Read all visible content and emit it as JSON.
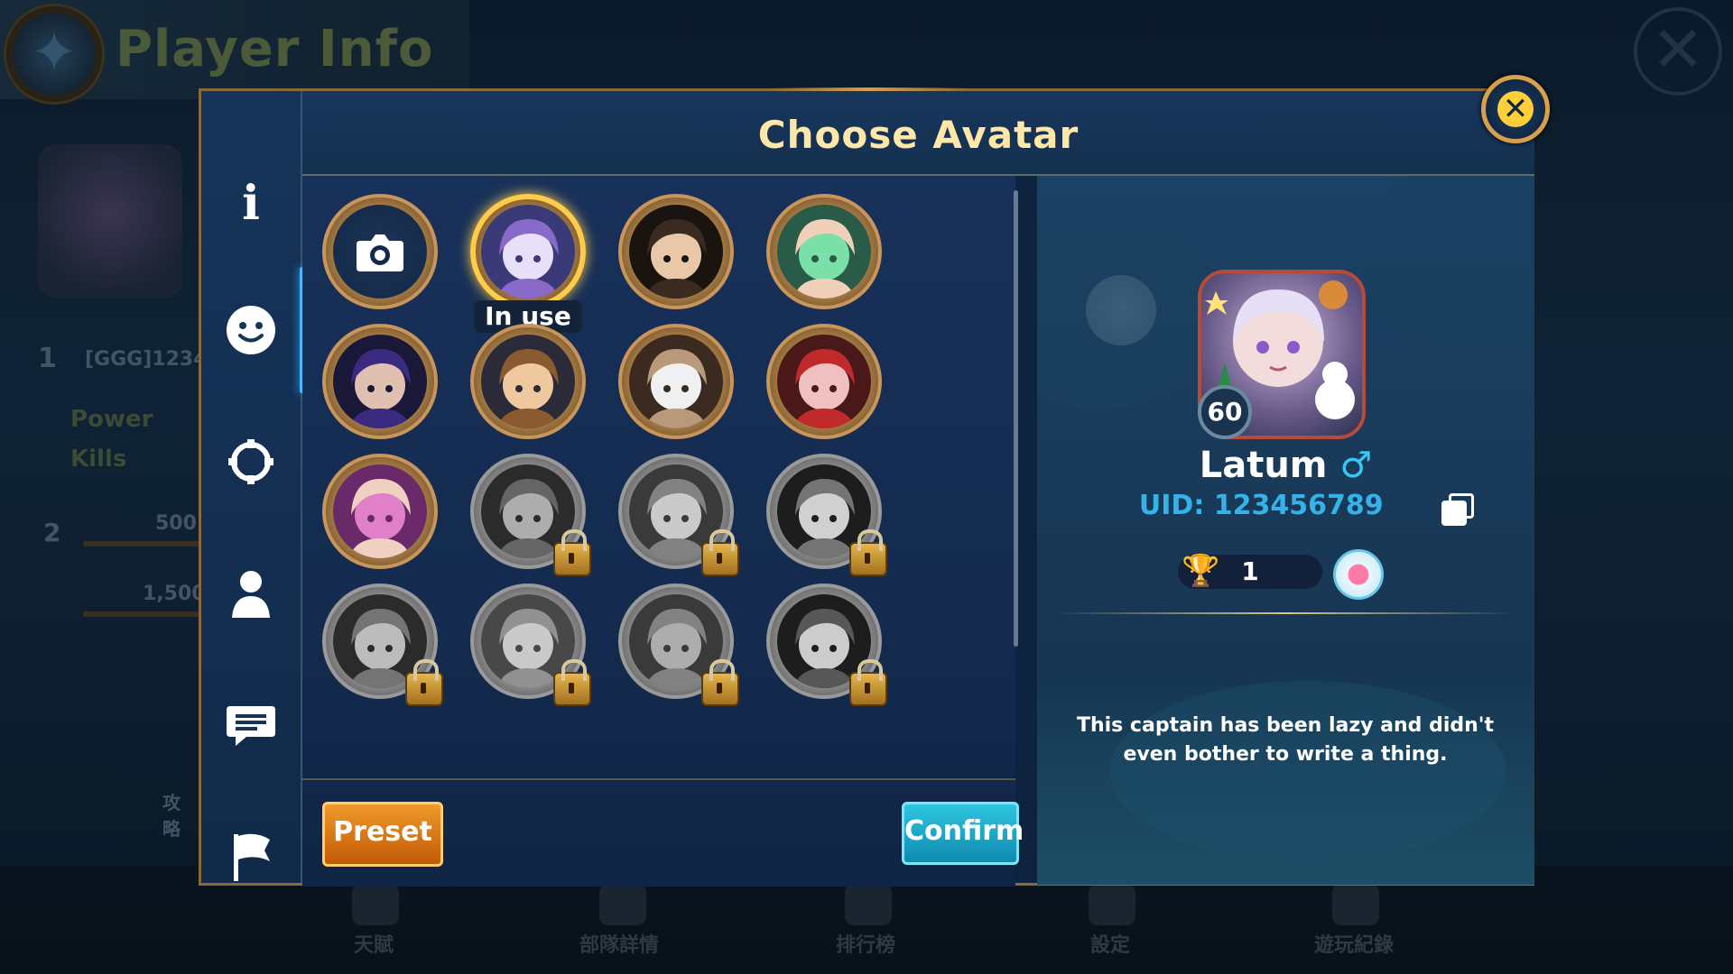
{
  "background": {
    "title": "Player Info",
    "player_tag": "[GGG]1234",
    "stats": [
      {
        "label": "Power"
      },
      {
        "label": "Kills"
      }
    ],
    "level_badge_1": "1",
    "level_badge_2": "2",
    "stat_values": [
      "500",
      "1,500"
    ],
    "side_link": "攻略",
    "bottom_nav": [
      "天賦",
      "部隊詳情",
      "排行榜",
      "設定",
      "遊玩紀錄"
    ]
  },
  "modal": {
    "title": "Choose Avatar",
    "tabs": [
      {
        "icon": "info-icon"
      },
      {
        "icon": "smiley-icon",
        "active": true
      },
      {
        "icon": "settings-ring-icon"
      },
      {
        "icon": "person-icon"
      },
      {
        "icon": "chat-icon"
      },
      {
        "icon": "flag-icon"
      }
    ],
    "avatars": [
      {
        "type": "camera",
        "icon": "camera-icon"
      },
      {
        "type": "avatar",
        "status": "in_use",
        "badge": "In use",
        "palette": [
          "#e8e0f8",
          "#8a6ac8",
          "#3a3a78"
        ]
      },
      {
        "type": "avatar",
        "palette": [
          "#e8c8a8",
          "#3a2a20",
          "#1a1410"
        ]
      },
      {
        "type": "avatar",
        "palette": [
          "#7ae0a8",
          "#f0d0b8",
          "#2a5a48"
        ]
      },
      {
        "type": "avatar",
        "palette": [
          "#e0c0b0",
          "#3a2a80",
          "#1a1838"
        ]
      },
      {
        "type": "avatar",
        "palette": [
          "#f0c8a0",
          "#8a5a30",
          "#2a2a38"
        ]
      },
      {
        "type": "avatar",
        "palette": [
          "#f0f0f0",
          "#b89a7a",
          "#3a2a20"
        ]
      },
      {
        "type": "avatar",
        "palette": [
          "#f0c0c0",
          "#c02a2a",
          "#4a1818"
        ]
      },
      {
        "type": "avatar",
        "palette": [
          "#e080c8",
          "#f0d0c0",
          "#6a2a6a"
        ]
      },
      {
        "type": "avatar",
        "locked": true,
        "palette": [
          "#cccccc",
          "#777777",
          "#333333"
        ]
      },
      {
        "type": "avatar",
        "locked": true,
        "palette": [
          "#eeeeee",
          "#999999",
          "#444444"
        ]
      },
      {
        "type": "avatar",
        "locked": true,
        "palette": [
          "#f5f5f5",
          "#888888",
          "#222222"
        ]
      },
      {
        "type": "avatar",
        "locked": true,
        "palette": [
          "#dddddd",
          "#888888",
          "#333333"
        ]
      },
      {
        "type": "avatar",
        "locked": true,
        "palette": [
          "#eeeeee",
          "#aaaaaa",
          "#555555"
        ]
      },
      {
        "type": "avatar",
        "locked": true,
        "palette": [
          "#cccccc",
          "#999999",
          "#444444"
        ]
      },
      {
        "type": "avatar",
        "locked": true,
        "palette": [
          "#f0f0f0",
          "#666666",
          "#222222"
        ]
      }
    ],
    "preset_label": "Preset",
    "confirm_label": "Confirm",
    "close_icon": "close-icon"
  },
  "profile": {
    "level": "60",
    "name": "Latum",
    "gender_symbol": "♂",
    "uid": "UID: 123456789",
    "trophies": "1",
    "bio": "This captain has been lazy and didn't even bother to write a thing."
  },
  "colors": {
    "title_gold": "#ffe7a8",
    "accent_blue": "#35b2e8",
    "preset_orange": "#e07a18",
    "confirm_cyan": "#1fb0d0",
    "frame_gold": "#c9955a"
  }
}
